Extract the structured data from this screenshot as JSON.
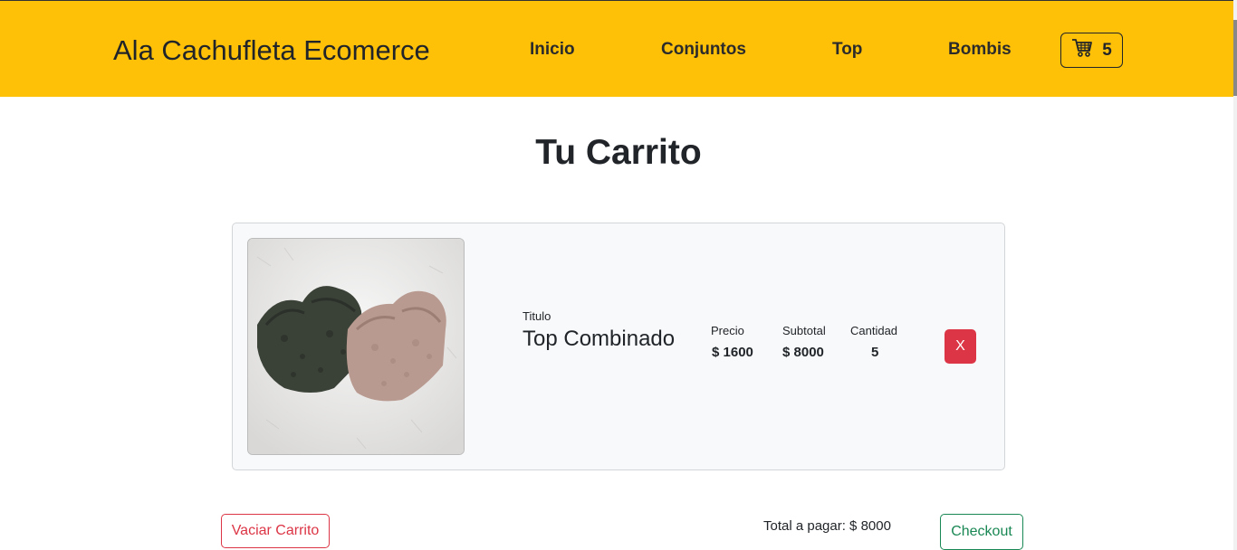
{
  "navbar": {
    "brand": "Ala Cachufleta Ecomerce",
    "links": [
      "Inicio",
      "Conjuntos",
      "Top",
      "Bombis"
    ],
    "cart_count": "5"
  },
  "page": {
    "title": "Tu Carrito"
  },
  "cart_item": {
    "title_label": "Titulo",
    "title": "Top Combinado",
    "price_label": "Precio",
    "price": "$ 1600",
    "subtotal_label": "Subtotal",
    "subtotal": "$ 8000",
    "quantity_label": "Cantidad",
    "quantity": "5",
    "remove_label": "X",
    "image_icon": "product-photo"
  },
  "footer": {
    "empty_cart_label": "Vaciar Carrito",
    "total_text": "Total a pagar: $ 8000",
    "checkout_label": "Checkout"
  },
  "colors": {
    "navbar": "#ffc107",
    "danger": "#dc3545",
    "success": "#198754",
    "card_bg": "#f8f9fa"
  }
}
